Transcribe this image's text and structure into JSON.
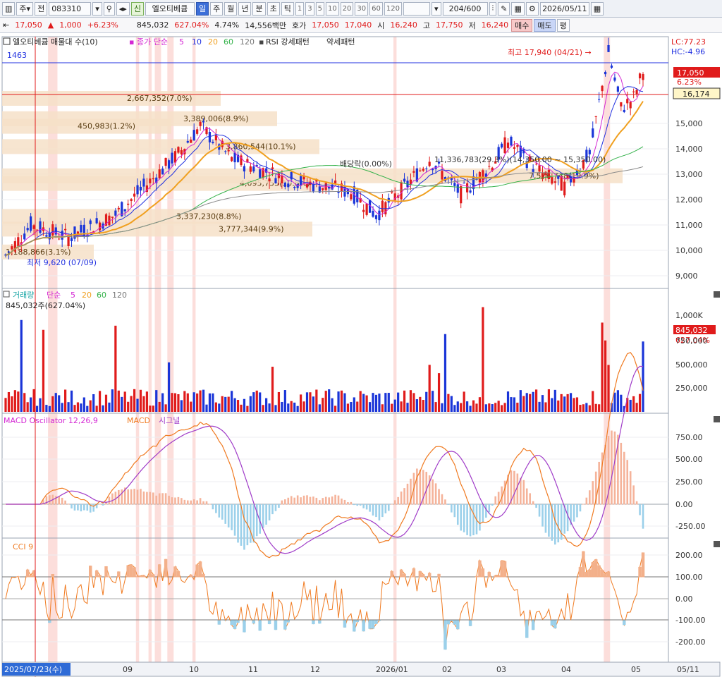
{
  "toolbar": {
    "period_type": "주",
    "prev_label": "전",
    "code": "083310",
    "new_badge": "신",
    "stock_name": "엘오티베큠",
    "periods": [
      "일",
      "주",
      "월",
      "년",
      "분",
      "초",
      "틱"
    ],
    "active_period": "일",
    "intervals": [
      "1",
      "3",
      "5",
      "10",
      "20",
      "30",
      "60",
      "120"
    ],
    "count": "204",
    "count_total": "/600",
    "date": "2026/05/11"
  },
  "quote": {
    "price": "17,050",
    "change": "1,000",
    "change_pct": "+6.23%",
    "volume": "845,032",
    "vol_ratio": "627.04%",
    "turnover": "4.74%",
    "amount": "14,556백만",
    "ask_label": "호가",
    "ask": "17,050",
    "bid": "17,040",
    "open_label": "시",
    "open": "16,240",
    "high_label": "고",
    "high": "17,750",
    "low_label": "저",
    "low": "16,240",
    "buy": "매수",
    "sell": "매도",
    "flat": "평"
  },
  "colors": {
    "up": "#e01b1b",
    "down": "#1a35d8",
    "ma5": "#d428d4",
    "ma10": "#2030e0",
    "ma20": "#f0a020",
    "ma60": "#34b24a",
    "ma120": "#8a8a8a",
    "band": "#f6e0c8",
    "hl": "#fbd0cc",
    "macd": "#f07a20",
    "signal": "#a03cc8"
  },
  "price_panel": {
    "legend_name": "엘오티베큠 매물대 수(10)",
    "legend_ma": "종가 단순",
    "ma_periods": [
      "5",
      "10",
      "20",
      "60",
      "120"
    ],
    "legend_rsi": "RSI 강세패턴",
    "legend_weak": "약세패턴",
    "lc": "LC:77.23",
    "hc": "HC:-4.96",
    "price_tag": "17,050",
    "pct_tag": "6.23%",
    "ref_tag": "16,174",
    "top_label": "1463",
    "high_note": "최고 17,940 (04/21) →",
    "low_note": "최저 9,620 (07/09)",
    "dividend": "배당락(0.00%)",
    "range_note": "11,336,783(29.3%)(14,350.00 ~ 15,350.00)",
    "y_ticks": [
      "15,000",
      "14,000",
      "13,000",
      "12,000",
      "11,000",
      "10,000",
      "9,000"
    ]
  },
  "volume_bands": [
    {
      "label": "2,667,352(7.0%)",
      "price": 16000
    },
    {
      "label": "3,389,006(8.9%)",
      "price": 15200
    },
    {
      "label": "450,983(1.2%)",
      "price": 14900
    },
    {
      "label": "3,860,544(10.1%)",
      "price": 14100
    },
    {
      "label": "4,095,755(10.8%)",
      "price": 12650
    },
    {
      "label": "3,337,230(8.8%)",
      "price": 11350
    },
    {
      "label": "3,777,344(9.9%)",
      "price": 10850
    },
    {
      "label": "1,188,866(3.1%)",
      "price": 9950
    },
    {
      "label": "7,576,748(19.9%)",
      "price": 12950
    }
  ],
  "volume_panel": {
    "legend_name": "거래량",
    "legend_ma": "단순",
    "ma_periods": [
      "5",
      "20",
      "60",
      "120"
    ],
    "sub": "845,032주(627.04%)",
    "tag": "845,032",
    "tag_pct": "627.04%",
    "y_ticks": [
      "1,000K",
      "750,000",
      "500,000",
      "250,000"
    ]
  },
  "macd_panel": {
    "legend_osc": "MACD Oscillator 12,26,9",
    "legend_macd": "MACD",
    "legend_signal": "시그널",
    "y_ticks": [
      "750.00",
      "500.00",
      "250.00",
      "0.00",
      "-250.00"
    ]
  },
  "cci_panel": {
    "legend": "CCI 9",
    "y_ticks": [
      "200.00",
      "100.00",
      "0.00",
      "-100.00",
      "-200.00"
    ]
  },
  "x_axis": {
    "cursor_date": "2025/07/23(수)",
    "months": [
      "09",
      "10",
      "11",
      "12",
      "2026/01",
      "02",
      "03",
      "04",
      "05"
    ],
    "right_label": "05/11"
  }
}
